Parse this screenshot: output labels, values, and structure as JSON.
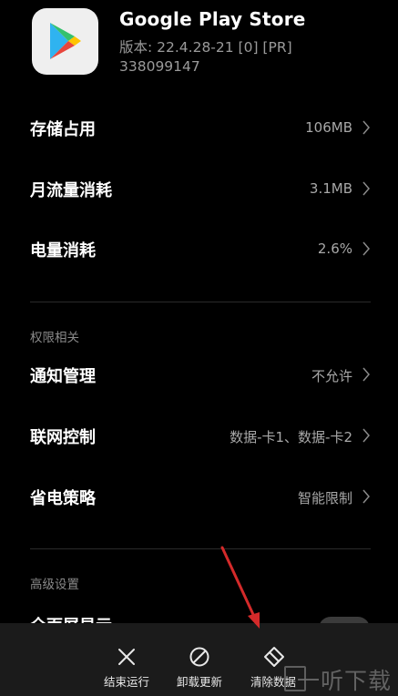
{
  "app": {
    "name": "Google Play Store",
    "version": "版本: 22.4.28-21 [0] [PR]",
    "id": "338099147",
    "icon": "google-play-icon"
  },
  "usage_rows": [
    {
      "label": "存储占用",
      "value": "106MB"
    },
    {
      "label": "月流量消耗",
      "value": "3.1MB"
    },
    {
      "label": "电量消耗",
      "value": "2.6%"
    }
  ],
  "permissions": {
    "header": "权限相关",
    "rows": [
      {
        "label": "通知管理",
        "value": "不允许"
      },
      {
        "label": "联网控制",
        "value": "数据-卡1、数据-卡2"
      },
      {
        "label": "省电策略",
        "value": "智能限制"
      }
    ]
  },
  "advanced": {
    "header": "高级设置",
    "rows": [
      {
        "label": "全面屏显示"
      }
    ]
  },
  "bottom_actions": [
    {
      "label": "结束运行",
      "icon": "close-icon"
    },
    {
      "label": "卸载更新",
      "icon": "block-icon"
    },
    {
      "label": "清除数据",
      "icon": "eraser-icon"
    }
  ],
  "watermark": "一听下载",
  "colors": {
    "background": "#000000",
    "bottom_bar": "#1b1b1b",
    "secondary_text": "#a8a8a8",
    "annotation_arrow": "#d42a2a"
  }
}
